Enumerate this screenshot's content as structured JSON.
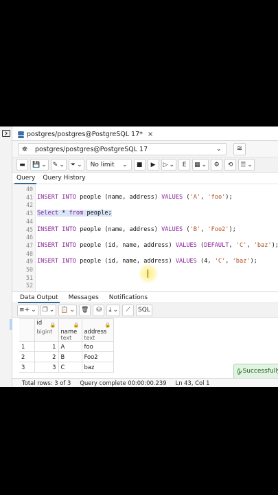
{
  "tab": {
    "title": "postgres/postgres@PostgreSQL 17*",
    "close": "×"
  },
  "connection": {
    "value": "postgres/postgres@PostgreSQL 17"
  },
  "toolbar": {
    "limit": "No limit"
  },
  "query_tabs": [
    "Query",
    "Query History"
  ],
  "editor": {
    "lines": [
      {
        "num": "40",
        "text": ""
      },
      {
        "num": "41",
        "text": "INSERT INTO people (name, address) VALUES ('A', 'foo');"
      },
      {
        "num": "42",
        "text": ""
      },
      {
        "num": "43",
        "text": "Select * from people;"
      },
      {
        "num": "44",
        "text": ""
      },
      {
        "num": "45",
        "text": "INSERT INTO people (name, address) VALUES ('B', 'Foo2');"
      },
      {
        "num": "46",
        "text": ""
      },
      {
        "num": "47",
        "text": "INSERT INTO people (id, name, address) VALUES (DEFAULT, 'C', 'baz');"
      },
      {
        "num": "48",
        "text": ""
      },
      {
        "num": "49",
        "text": "INSERT INTO people (id, name, address) VALUES (4, 'C', 'baz');"
      },
      {
        "num": "50",
        "text": ""
      },
      {
        "num": "51",
        "text": ""
      },
      {
        "num": "52",
        "text": ""
      }
    ]
  },
  "result_tabs": [
    "Data Output",
    "Messages",
    "Notifications"
  ],
  "result_toolbar": {
    "sql_label": "SQL"
  },
  "grid": {
    "columns": [
      {
        "name": "id",
        "type": "bigint"
      },
      {
        "name": "name",
        "type": "text"
      },
      {
        "name": "address",
        "type": "text"
      }
    ],
    "rows": [
      {
        "rn": "1",
        "id": "1",
        "name": "A",
        "address": "foo"
      },
      {
        "rn": "2",
        "id": "2",
        "name": "B",
        "address": "Foo2"
      },
      {
        "rn": "3",
        "id": "3",
        "name": "C",
        "address": "baz"
      }
    ]
  },
  "toast": {
    "text": "Successfully"
  },
  "status": {
    "total_rows": "Total rows: 3 of 3",
    "query_time": "Query complete 00:00:00.239",
    "cursor_pos": "Ln 43, Col 1"
  },
  "colors": {
    "accent": "#326690",
    "keyword": "#8a1f9a",
    "string": "#b04e1b",
    "highlight": "#d9e6f7",
    "toast_bg": "#e3f3e3"
  }
}
